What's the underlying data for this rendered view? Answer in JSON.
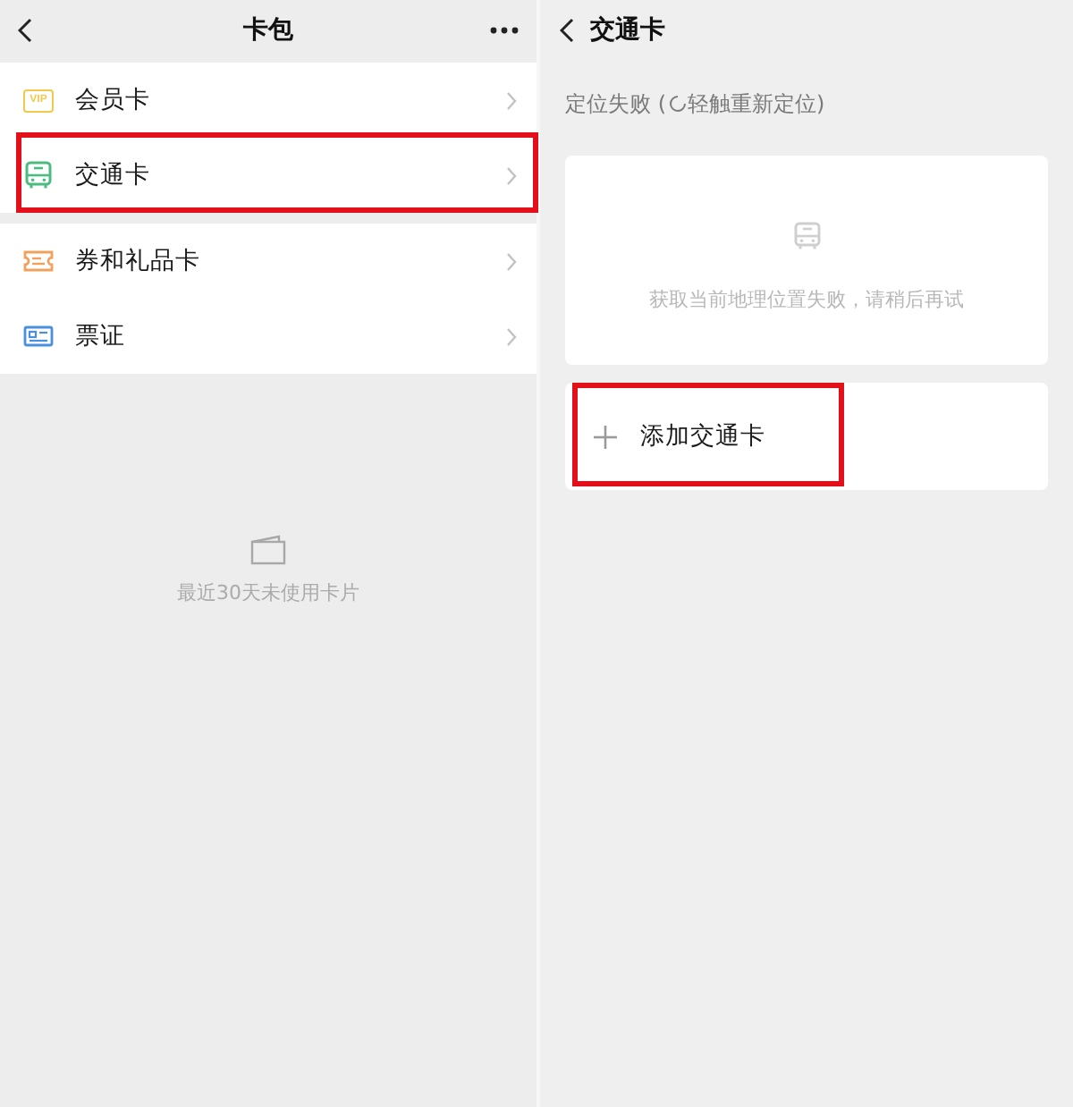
{
  "left_panel": {
    "title": "卡包",
    "groups": [
      {
        "items": [
          {
            "label": "会员卡",
            "kind": "membership",
            "badge": "VIP",
            "color": "#f2c94c",
            "highlighted": false
          },
          {
            "label": "交通卡",
            "kind": "transit",
            "color": "#4cbb7f",
            "highlighted": true
          }
        ]
      },
      {
        "items": [
          {
            "label": "券和礼品卡",
            "kind": "coupon",
            "color": "#f0a15e",
            "highlighted": false
          },
          {
            "label": "票证",
            "kind": "ticket",
            "color": "#4a8fe0",
            "highlighted": false
          }
        ]
      }
    ],
    "empty_state": {
      "text": "最近30天未使用卡片"
    }
  },
  "right_panel": {
    "title": "交通卡",
    "location_status": {
      "text": "定位失败 (",
      "action": "轻触重新定位)"
    },
    "error_card": {
      "message": "获取当前地理位置失败，请稍后再试"
    },
    "add_button": {
      "label": "添加交通卡",
      "highlighted": true
    }
  }
}
